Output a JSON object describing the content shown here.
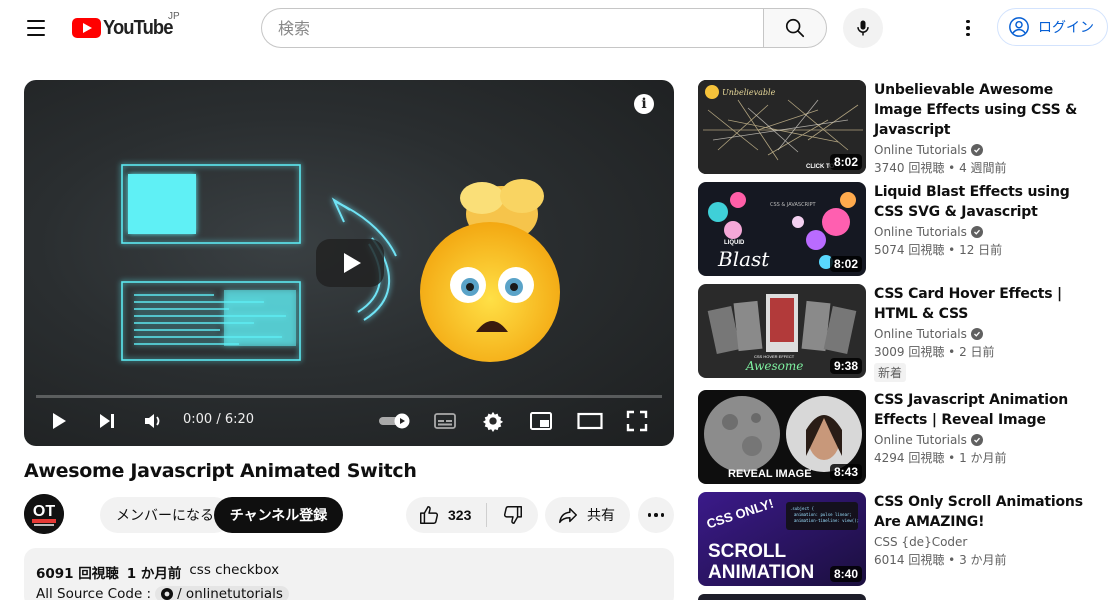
{
  "header": {
    "logo_text": "YouTube",
    "region": "JP",
    "search_placeholder": "検索",
    "login_label": "ログイン",
    "icons": [
      "menu-icon",
      "search-icon",
      "mic-icon",
      "more-vert-icon",
      "account-circle-icon"
    ]
  },
  "player": {
    "time": "0:00 / 6:20",
    "progress": 0.0,
    "accent_color": "#ff0000"
  },
  "video": {
    "title": "Awesome Javascript Animated Switch",
    "channel_avatar_text": "OT",
    "member_label": "メンバーになる",
    "subscribe_label": "チャンネル登録",
    "likes": "323",
    "share_label": "共有"
  },
  "description": {
    "views": "6091 回視聴",
    "date": "1 か月前",
    "tag": "css checkbox",
    "source_label": "All Source Code :",
    "source_link": "/ onlinetutorials"
  },
  "recommendations": [
    {
      "title": "Unbelievable Awesome Image Effects using CSS & Javascript",
      "channel": "Online Tutorials",
      "verified": true,
      "views": "3740 回視聴",
      "age": "4 週間前",
      "duration": "8:02",
      "thumb_text": "Unbelievable",
      "thumb_sub": "CLICK TO",
      "badge": ""
    },
    {
      "title": "Liquid Blast Effects using CSS SVG & Javascript",
      "channel": "Online Tutorials",
      "verified": true,
      "views": "5074 回視聴",
      "age": "12 日前",
      "duration": "8:02",
      "thumb_text": "Blast",
      "thumb_sub": "LIQUID",
      "badge": ""
    },
    {
      "title": "CSS Card Hover Effects | HTML & CSS",
      "channel": "Online Tutorials",
      "verified": true,
      "views": "3009 回視聴",
      "age": "2 日前",
      "duration": "9:38",
      "thumb_text": "Awesome",
      "thumb_sub": "CSS HOVER EFFECT",
      "badge": "新着"
    },
    {
      "title": "CSS Javascript Animation Effects | Reveal Image",
      "channel": "Online Tutorials",
      "verified": true,
      "views": "4294 回視聴",
      "age": "1 か月前",
      "duration": "8:43",
      "thumb_text": "REVEAL IMAGE",
      "thumb_sub": "",
      "badge": ""
    },
    {
      "title": "CSS Only Scroll Animations Are AMAZING!",
      "channel": "CSS {de}Coder",
      "verified": false,
      "views": "6014 回視聴",
      "age": "3 か月前",
      "duration": "8:40",
      "thumb_text": "SCROLL ANIMATION",
      "thumb_sub": "CSS ONLY!",
      "badge": ""
    }
  ]
}
